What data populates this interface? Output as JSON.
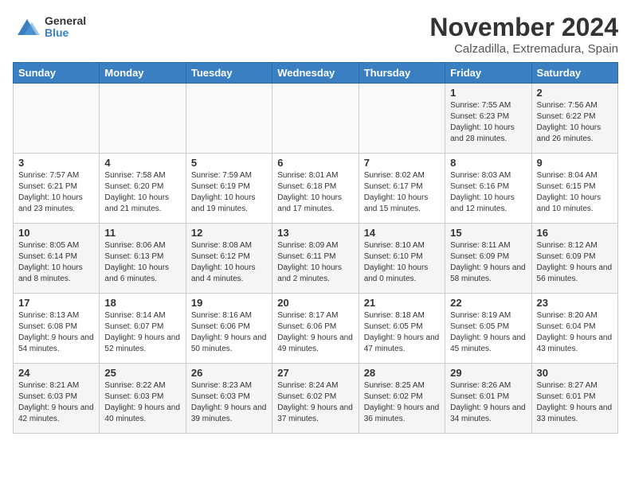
{
  "header": {
    "logo_general": "General",
    "logo_blue": "Blue",
    "month_title": "November 2024",
    "location": "Calzadilla, Extremadura, Spain"
  },
  "days_of_week": [
    "Sunday",
    "Monday",
    "Tuesday",
    "Wednesday",
    "Thursday",
    "Friday",
    "Saturday"
  ],
  "weeks": [
    [
      {
        "day": "",
        "info": ""
      },
      {
        "day": "",
        "info": ""
      },
      {
        "day": "",
        "info": ""
      },
      {
        "day": "",
        "info": ""
      },
      {
        "day": "",
        "info": ""
      },
      {
        "day": "1",
        "info": "Sunrise: 7:55 AM\nSunset: 6:23 PM\nDaylight: 10 hours\nand 28 minutes."
      },
      {
        "day": "2",
        "info": "Sunrise: 7:56 AM\nSunset: 6:22 PM\nDaylight: 10 hours\nand 26 minutes."
      }
    ],
    [
      {
        "day": "3",
        "info": "Sunrise: 7:57 AM\nSunset: 6:21 PM\nDaylight: 10 hours\nand 23 minutes."
      },
      {
        "day": "4",
        "info": "Sunrise: 7:58 AM\nSunset: 6:20 PM\nDaylight: 10 hours\nand 21 minutes."
      },
      {
        "day": "5",
        "info": "Sunrise: 7:59 AM\nSunset: 6:19 PM\nDaylight: 10 hours\nand 19 minutes."
      },
      {
        "day": "6",
        "info": "Sunrise: 8:01 AM\nSunset: 6:18 PM\nDaylight: 10 hours\nand 17 minutes."
      },
      {
        "day": "7",
        "info": "Sunrise: 8:02 AM\nSunset: 6:17 PM\nDaylight: 10 hours\nand 15 minutes."
      },
      {
        "day": "8",
        "info": "Sunrise: 8:03 AM\nSunset: 6:16 PM\nDaylight: 10 hours\nand 12 minutes."
      },
      {
        "day": "9",
        "info": "Sunrise: 8:04 AM\nSunset: 6:15 PM\nDaylight: 10 hours\nand 10 minutes."
      }
    ],
    [
      {
        "day": "10",
        "info": "Sunrise: 8:05 AM\nSunset: 6:14 PM\nDaylight: 10 hours\nand 8 minutes."
      },
      {
        "day": "11",
        "info": "Sunrise: 8:06 AM\nSunset: 6:13 PM\nDaylight: 10 hours\nand 6 minutes."
      },
      {
        "day": "12",
        "info": "Sunrise: 8:08 AM\nSunset: 6:12 PM\nDaylight: 10 hours\nand 4 minutes."
      },
      {
        "day": "13",
        "info": "Sunrise: 8:09 AM\nSunset: 6:11 PM\nDaylight: 10 hours\nand 2 minutes."
      },
      {
        "day": "14",
        "info": "Sunrise: 8:10 AM\nSunset: 6:10 PM\nDaylight: 10 hours\nand 0 minutes."
      },
      {
        "day": "15",
        "info": "Sunrise: 8:11 AM\nSunset: 6:09 PM\nDaylight: 9 hours\nand 58 minutes."
      },
      {
        "day": "16",
        "info": "Sunrise: 8:12 AM\nSunset: 6:09 PM\nDaylight: 9 hours\nand 56 minutes."
      }
    ],
    [
      {
        "day": "17",
        "info": "Sunrise: 8:13 AM\nSunset: 6:08 PM\nDaylight: 9 hours\nand 54 minutes."
      },
      {
        "day": "18",
        "info": "Sunrise: 8:14 AM\nSunset: 6:07 PM\nDaylight: 9 hours\nand 52 minutes."
      },
      {
        "day": "19",
        "info": "Sunrise: 8:16 AM\nSunset: 6:06 PM\nDaylight: 9 hours\nand 50 minutes."
      },
      {
        "day": "20",
        "info": "Sunrise: 8:17 AM\nSunset: 6:06 PM\nDaylight: 9 hours\nand 49 minutes."
      },
      {
        "day": "21",
        "info": "Sunrise: 8:18 AM\nSunset: 6:05 PM\nDaylight: 9 hours\nand 47 minutes."
      },
      {
        "day": "22",
        "info": "Sunrise: 8:19 AM\nSunset: 6:05 PM\nDaylight: 9 hours\nand 45 minutes."
      },
      {
        "day": "23",
        "info": "Sunrise: 8:20 AM\nSunset: 6:04 PM\nDaylight: 9 hours\nand 43 minutes."
      }
    ],
    [
      {
        "day": "24",
        "info": "Sunrise: 8:21 AM\nSunset: 6:03 PM\nDaylight: 9 hours\nand 42 minutes."
      },
      {
        "day": "25",
        "info": "Sunrise: 8:22 AM\nSunset: 6:03 PM\nDaylight: 9 hours\nand 40 minutes."
      },
      {
        "day": "26",
        "info": "Sunrise: 8:23 AM\nSunset: 6:03 PM\nDaylight: 9 hours\nand 39 minutes."
      },
      {
        "day": "27",
        "info": "Sunrise: 8:24 AM\nSunset: 6:02 PM\nDaylight: 9 hours\nand 37 minutes."
      },
      {
        "day": "28",
        "info": "Sunrise: 8:25 AM\nSunset: 6:02 PM\nDaylight: 9 hours\nand 36 minutes."
      },
      {
        "day": "29",
        "info": "Sunrise: 8:26 AM\nSunset: 6:01 PM\nDaylight: 9 hours\nand 34 minutes."
      },
      {
        "day": "30",
        "info": "Sunrise: 8:27 AM\nSunset: 6:01 PM\nDaylight: 9 hours\nand 33 minutes."
      }
    ]
  ]
}
